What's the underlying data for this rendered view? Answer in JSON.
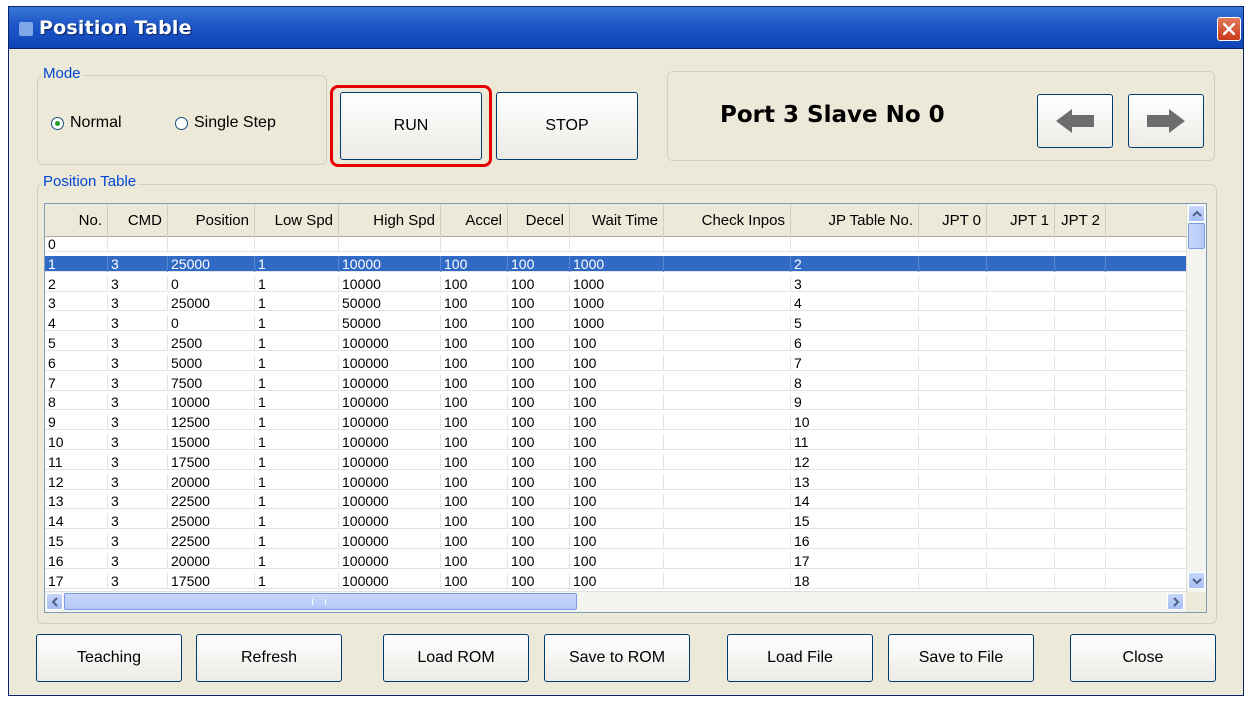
{
  "window": {
    "title": "Position Table",
    "close_icon": "close-icon"
  },
  "mode": {
    "label": "Mode",
    "options": [
      {
        "label": "Normal",
        "selected": true
      },
      {
        "label": "Single Step",
        "selected": false
      }
    ]
  },
  "controls": {
    "run_label": "RUN",
    "stop_label": "STOP"
  },
  "port": {
    "label": "Port 3 Slave No 0",
    "prev_icon": "arrow-left-icon",
    "next_icon": "arrow-right-icon"
  },
  "table": {
    "label": "Position Table",
    "columns": [
      "No.",
      "CMD",
      "Position",
      "Low Spd",
      "High Spd",
      "Accel",
      "Decel",
      "Wait Time",
      "Check Inpos",
      "JP Table No.",
      "JPT 0",
      "JPT 1",
      "JPT 2"
    ],
    "selected_row": 1,
    "rows": [
      [
        "0",
        "",
        "",
        "",
        "",
        "",
        "",
        "",
        "",
        "",
        "",
        "",
        ""
      ],
      [
        "1",
        "3",
        "25000",
        "1",
        "10000",
        "100",
        "100",
        "1000",
        "",
        "2",
        "",
        "",
        ""
      ],
      [
        "2",
        "3",
        "0",
        "1",
        "10000",
        "100",
        "100",
        "1000",
        "",
        "3",
        "",
        "",
        ""
      ],
      [
        "3",
        "3",
        "25000",
        "1",
        "50000",
        "100",
        "100",
        "1000",
        "",
        "4",
        "",
        "",
        ""
      ],
      [
        "4",
        "3",
        "0",
        "1",
        "50000",
        "100",
        "100",
        "1000",
        "",
        "5",
        "",
        "",
        ""
      ],
      [
        "5",
        "3",
        "2500",
        "1",
        "100000",
        "100",
        "100",
        "100",
        "",
        "6",
        "",
        "",
        ""
      ],
      [
        "6",
        "3",
        "5000",
        "1",
        "100000",
        "100",
        "100",
        "100",
        "",
        "7",
        "",
        "",
        ""
      ],
      [
        "7",
        "3",
        "7500",
        "1",
        "100000",
        "100",
        "100",
        "100",
        "",
        "8",
        "",
        "",
        ""
      ],
      [
        "8",
        "3",
        "10000",
        "1",
        "100000",
        "100",
        "100",
        "100",
        "",
        "9",
        "",
        "",
        ""
      ],
      [
        "9",
        "3",
        "12500",
        "1",
        "100000",
        "100",
        "100",
        "100",
        "",
        "10",
        "",
        "",
        ""
      ],
      [
        "10",
        "3",
        "15000",
        "1",
        "100000",
        "100",
        "100",
        "100",
        "",
        "11",
        "",
        "",
        ""
      ],
      [
        "11",
        "3",
        "17500",
        "1",
        "100000",
        "100",
        "100",
        "100",
        "",
        "12",
        "",
        "",
        ""
      ],
      [
        "12",
        "3",
        "20000",
        "1",
        "100000",
        "100",
        "100",
        "100",
        "",
        "13",
        "",
        "",
        ""
      ],
      [
        "13",
        "3",
        "22500",
        "1",
        "100000",
        "100",
        "100",
        "100",
        "",
        "14",
        "",
        "",
        ""
      ],
      [
        "14",
        "3",
        "25000",
        "1",
        "100000",
        "100",
        "100",
        "100",
        "",
        "15",
        "",
        "",
        ""
      ],
      [
        "15",
        "3",
        "22500",
        "1",
        "100000",
        "100",
        "100",
        "100",
        "",
        "16",
        "",
        "",
        ""
      ],
      [
        "16",
        "3",
        "20000",
        "1",
        "100000",
        "100",
        "100",
        "100",
        "",
        "17",
        "",
        "",
        ""
      ],
      [
        "17",
        "3",
        "17500",
        "1",
        "100000",
        "100",
        "100",
        "100",
        "",
        "18",
        "",
        "",
        ""
      ]
    ]
  },
  "footer": {
    "buttons": [
      "Teaching",
      "Refresh",
      "Load ROM",
      "Save to ROM",
      "Load File",
      "Save to File",
      "Close"
    ]
  },
  "colors": {
    "title_bar": "#0d45b8",
    "selection": "#316ac5",
    "highlight_box": "#e60000",
    "group_label": "#0046d5"
  }
}
